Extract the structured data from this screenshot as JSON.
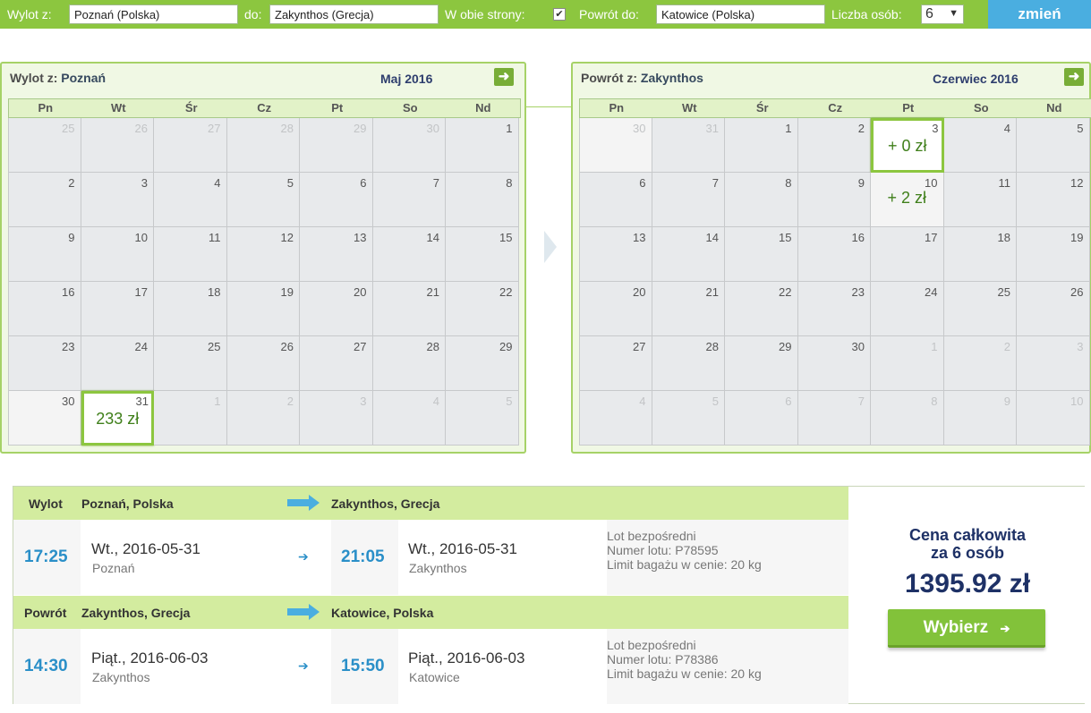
{
  "search": {
    "from_label": "Wylot z:",
    "from_value": "Poznań (Polska)",
    "to_label": "do:",
    "to_value": "Zakynthos (Grecja)",
    "roundtrip_label": "W obie strony:",
    "roundtrip_checked": "✔",
    "return_label": "Powrót do:",
    "return_value": "Katowice (Polska)",
    "persons_label": "Liczba osób:",
    "persons_value": "6",
    "change_button": "zmień"
  },
  "outbound_calendar": {
    "header_label": "Wylot z:",
    "header_city": "Poznań",
    "month": "Maj 2016",
    "weekdays": [
      "Pn",
      "Wt",
      "Śr",
      "Cz",
      "Pt",
      "So",
      "Nd"
    ],
    "weeks": [
      [
        {
          "n": "25",
          "m": true
        },
        {
          "n": "26",
          "m": true
        },
        {
          "n": "27",
          "m": true
        },
        {
          "n": "28",
          "m": true
        },
        {
          "n": "29",
          "m": true
        },
        {
          "n": "30",
          "m": true
        },
        {
          "n": "1"
        }
      ],
      [
        {
          "n": "2"
        },
        {
          "n": "3"
        },
        {
          "n": "4"
        },
        {
          "n": "5"
        },
        {
          "n": "6"
        },
        {
          "n": "7"
        },
        {
          "n": "8"
        }
      ],
      [
        {
          "n": "9"
        },
        {
          "n": "10"
        },
        {
          "n": "11"
        },
        {
          "n": "12"
        },
        {
          "n": "13"
        },
        {
          "n": "14"
        },
        {
          "n": "15"
        }
      ],
      [
        {
          "n": "16"
        },
        {
          "n": "17"
        },
        {
          "n": "18"
        },
        {
          "n": "19"
        },
        {
          "n": "20"
        },
        {
          "n": "21"
        },
        {
          "n": "22"
        }
      ],
      [
        {
          "n": "23"
        },
        {
          "n": "24"
        },
        {
          "n": "25"
        },
        {
          "n": "26"
        },
        {
          "n": "27"
        },
        {
          "n": "28"
        },
        {
          "n": "29"
        }
      ],
      [
        {
          "n": "30",
          "lite": true
        },
        {
          "n": "31",
          "price": "233 zł",
          "sel": true
        },
        {
          "n": "1",
          "m": true
        },
        {
          "n": "2",
          "m": true
        },
        {
          "n": "3",
          "m": true
        },
        {
          "n": "4",
          "m": true
        },
        {
          "n": "5",
          "m": true
        }
      ]
    ]
  },
  "return_calendar": {
    "header_label": "Powrót z:",
    "header_city": "Zakynthos",
    "month": "Czerwiec 2016",
    "weekdays": [
      "Pn",
      "Wt",
      "Śr",
      "Cz",
      "Pt",
      "So",
      "Nd"
    ],
    "weeks": [
      [
        {
          "n": "30",
          "m": true,
          "lite": true
        },
        {
          "n": "31",
          "m": true
        },
        {
          "n": "1"
        },
        {
          "n": "2"
        },
        {
          "n": "3",
          "price": "+ 0 zł",
          "sel": true
        },
        {
          "n": "4"
        },
        {
          "n": "5"
        }
      ],
      [
        {
          "n": "6"
        },
        {
          "n": "7"
        },
        {
          "n": "8"
        },
        {
          "n": "9"
        },
        {
          "n": "10",
          "price": "+ 2 zł",
          "offer": true
        },
        {
          "n": "11"
        },
        {
          "n": "12"
        }
      ],
      [
        {
          "n": "13"
        },
        {
          "n": "14"
        },
        {
          "n": "15"
        },
        {
          "n": "16"
        },
        {
          "n": "17"
        },
        {
          "n": "18"
        },
        {
          "n": "19"
        }
      ],
      [
        {
          "n": "20"
        },
        {
          "n": "21"
        },
        {
          "n": "22"
        },
        {
          "n": "23"
        },
        {
          "n": "24"
        },
        {
          "n": "25"
        },
        {
          "n": "26"
        }
      ],
      [
        {
          "n": "27"
        },
        {
          "n": "28"
        },
        {
          "n": "29"
        },
        {
          "n": "30"
        },
        {
          "n": "1",
          "m": true
        },
        {
          "n": "2",
          "m": true
        },
        {
          "n": "3",
          "m": true
        }
      ],
      [
        {
          "n": "4",
          "m": true
        },
        {
          "n": "5",
          "m": true
        },
        {
          "n": "6",
          "m": true
        },
        {
          "n": "7",
          "m": true
        },
        {
          "n": "8",
          "m": true
        },
        {
          "n": "9",
          "m": true
        },
        {
          "n": "10",
          "m": true
        }
      ]
    ]
  },
  "outbound_leg": {
    "label": "Wylot",
    "from": "Poznań, Polska",
    "to": "Zakynthos, Grecja",
    "dep_time": "17:25",
    "dep_date": "Wt., 2016-05-31",
    "dep_city": "Poznań",
    "arr_time": "21:05",
    "arr_date": "Wt., 2016-05-31",
    "arr_city": "Zakynthos",
    "info_1": "Lot bezpośredni",
    "info_2": "Numer lotu: P78595",
    "info_3": "Limit bagażu w cenie: 20 kg"
  },
  "return_leg": {
    "label": "Powrót",
    "from": "Zakynthos, Grecja",
    "to": "Katowice, Polska",
    "dep_time": "14:30",
    "dep_date": "Piąt., 2016-06-03",
    "dep_city": "Zakynthos",
    "arr_time": "15:50",
    "arr_date": "Piąt., 2016-06-03",
    "arr_city": "Katowice",
    "info_1": "Lot bezpośredni",
    "info_2": "Numer lotu: P78386",
    "info_3": "Limit bagażu w cenie: 20 kg"
  },
  "price": {
    "label_line1": "Cena całkowita",
    "label_line2": "za 6 osób",
    "total": "1395.92 zł",
    "choose_button": "Wybierz",
    "choose_arrow": "➔"
  },
  "icons": {
    "next_month": "arrow-right-icon",
    "leg_arrow": "big-arrow-right-icon",
    "small_arrow": "small-arrow-right-icon"
  },
  "colors": {
    "accent_green": "#8cc63f",
    "accent_blue": "#4aaee0",
    "price_green": "#3f7f1a",
    "navy": "#1e3166"
  }
}
